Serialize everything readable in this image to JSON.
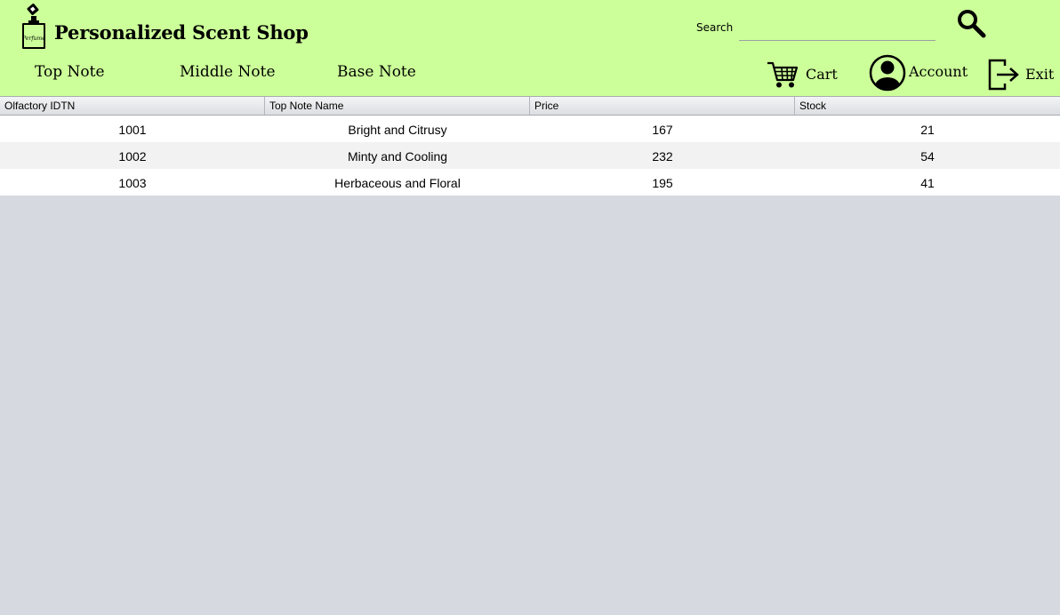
{
  "header": {
    "title": "Personalized Scent Shop",
    "logo_icon": "perfume-bottle-icon",
    "search_label": "Search",
    "search_value": "",
    "search_icon": "magnifier-icon",
    "background": "#ccff99"
  },
  "nav": {
    "items": [
      {
        "label": "Top Note"
      },
      {
        "label": "Middle Note"
      },
      {
        "label": "Base Note"
      }
    ]
  },
  "actions": {
    "cart_label": "Cart",
    "cart_icon": "cart-icon",
    "account_label": "Account",
    "account_icon": "user-icon",
    "exit_label": "Exit",
    "exit_icon": "exit-icon"
  },
  "table": {
    "columns": [
      "Olfactory IDTN",
      "Top Note Name",
      "Price",
      "Stock"
    ],
    "rows": [
      [
        "1001",
        "Bright and Citrusy",
        "167",
        "21"
      ],
      [
        "1002",
        "Minty and Cooling",
        "232",
        "54"
      ],
      [
        "1003",
        "Herbaceous and Floral",
        "195",
        "41"
      ]
    ]
  }
}
